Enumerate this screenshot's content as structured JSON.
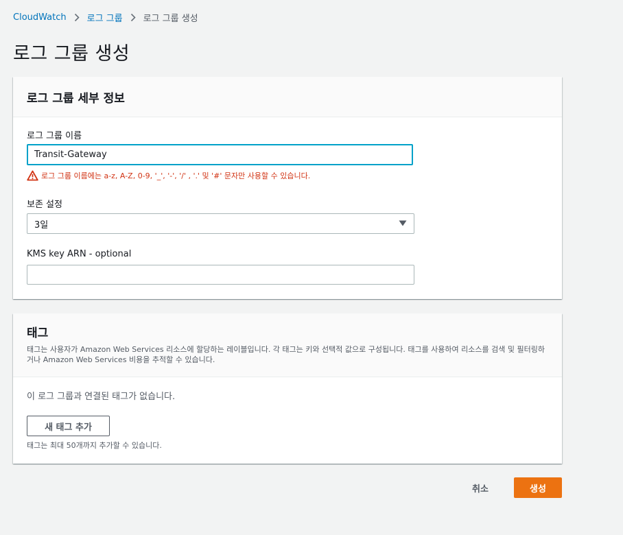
{
  "breadcrumb": {
    "items": [
      {
        "label": "CloudWatch"
      },
      {
        "label": "로그 그룹"
      },
      {
        "label": "로그 그룹 생성"
      }
    ]
  },
  "page_title": "로그 그룹 생성",
  "details_panel": {
    "title": "로그 그룹 세부 정보",
    "name_field": {
      "label": "로그 그룹 이름",
      "value": "Transit-Gateway",
      "error": "로그 그룹 이름에는 a-z, A-Z, 0-9, '_', '-', '/' , '.' 및 '#' 문자만 사용할 수 있습니다."
    },
    "retention_field": {
      "label": "보존 설정",
      "selected": "3일"
    },
    "kms_field": {
      "label": "KMS key ARN - optional",
      "value": ""
    }
  },
  "tags_panel": {
    "title": "태그",
    "description": "태그는 사용자가 Amazon Web Services 리소스에 할당하는 레이블입니다. 각 태그는 키와 선택적 값으로 구성됩니다. 태그를 사용하여 리소스를 검색 및 필터링하거나 Amazon Web Services 비용을 추적할 수 있습니다.",
    "empty_text": "이 로그 그룹과 연결된 태그가 없습니다.",
    "add_button": "새 태그 추가",
    "limit_text": "태그는 최대 50개까지 추가할 수 있습니다."
  },
  "actions": {
    "cancel": "취소",
    "create": "생성"
  },
  "colors": {
    "link": "#0073bb",
    "primary": "#ec7211",
    "error": "#d13212",
    "focus": "#00a1c9"
  }
}
